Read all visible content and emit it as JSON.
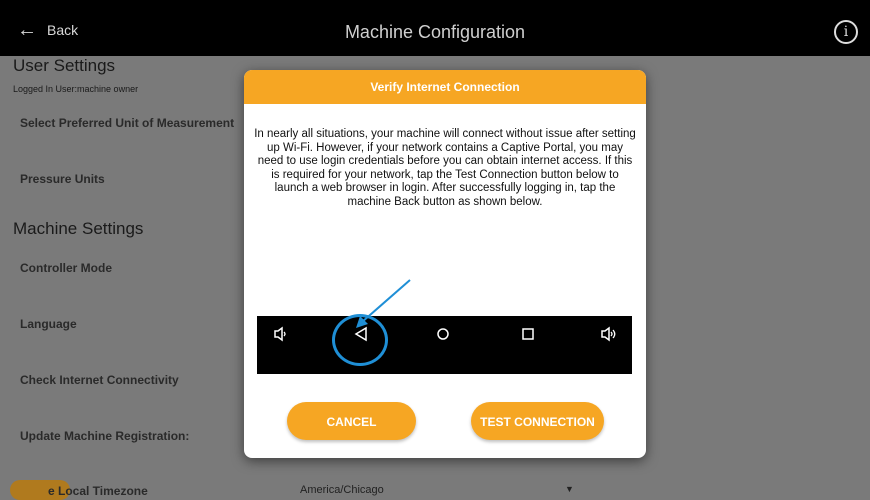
{
  "appbar": {
    "back_label": "Back",
    "title": "Machine Configuration"
  },
  "user_settings": {
    "heading": "User Settings",
    "logged_in": "Logged In User:machine owner",
    "items": [
      "Select Preferred Unit of Measurement",
      "Pressure Units"
    ]
  },
  "machine_settings": {
    "heading": "Machine Settings",
    "items": [
      "Controller Mode",
      "Language",
      "Check Internet Connectivity",
      "Update Machine Registration:"
    ],
    "timezone_label": "e Local Timezone",
    "timezone_value": "America/Chicago"
  },
  "dialog": {
    "title": "Verify Internet Connection",
    "body": "In nearly all situations, your machine will connect without issue after setting up Wi-Fi. However, if your network contains a Captive Portal, you may need to use login credentials before you can obtain internet access. If this is required for your network, tap the Test Connection button below to launch a web browser in login. After successfully logging in, tap the machine Back button as shown below.",
    "cancel_label": "CANCEL",
    "test_label": "TEST CONNECTION"
  },
  "colors": {
    "accent": "#f6a623",
    "highlight": "#1f8fd6",
    "overlay": "#7a7a7a"
  }
}
